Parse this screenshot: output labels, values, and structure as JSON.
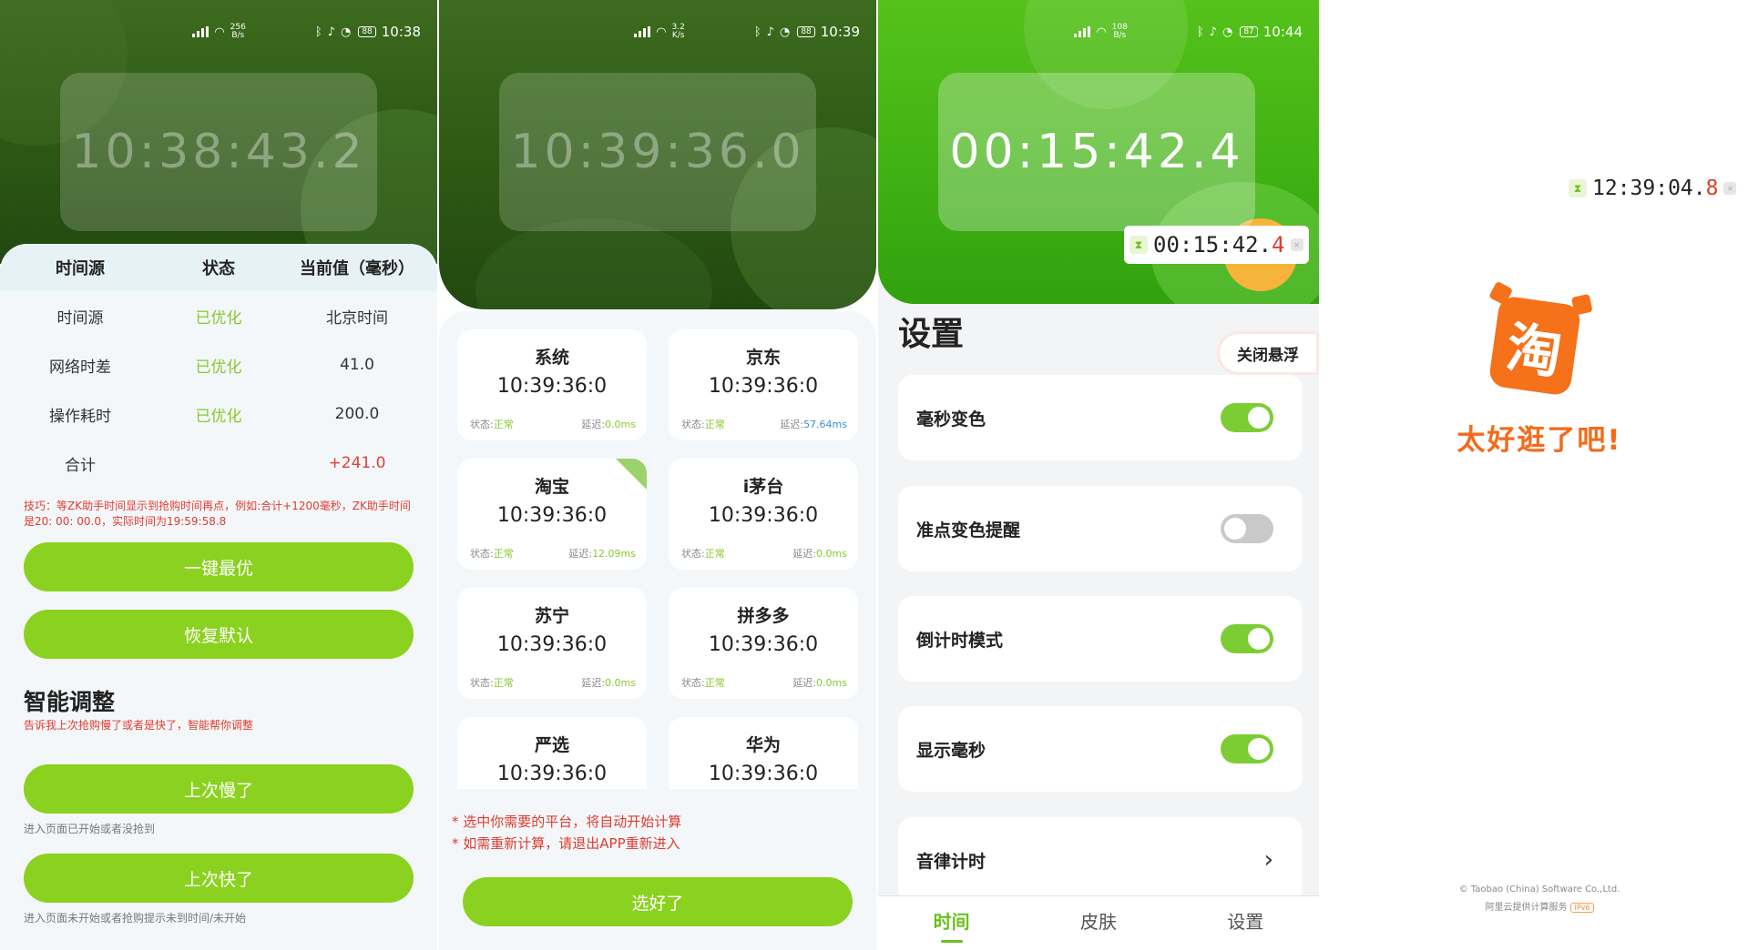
{
  "screen1": {
    "status": {
      "speed_top": "256",
      "speed_unit": "B/s",
      "battery": "88",
      "time": "10:38"
    },
    "clock": "10:38:43.2",
    "table": {
      "headers": [
        "时间源",
        "状态",
        "当前值（毫秒）"
      ],
      "rows": [
        {
          "name": "时间源",
          "status": "已优化",
          "value": "北京时间"
        },
        {
          "name": "网络时差",
          "status": "已优化",
          "value": "41.0"
        },
        {
          "name": "操作耗时",
          "status": "已优化",
          "value": "200.0"
        }
      ],
      "total_label": "合计",
      "total_value": "+241.0"
    },
    "tip": "技巧：等ZK助手时间显示到抢购时间再点，例如:合计+1200毫秒，ZK助手时间是20: 00: 00.0，实际时间为19:59:58.8",
    "btn_best": "一键最优",
    "btn_reset": "恢复默认",
    "smart_title": "智能调整",
    "smart_sub": "告诉我上次抢购慢了或者是快了，智能帮你调整",
    "btn_slow": "上次慢了",
    "slow_hint": "进入页面已开始或者没抢到",
    "btn_fast": "上次快了",
    "fast_hint": "进入页面未开始或者抢购提示未到时间/未开始"
  },
  "screen2": {
    "status": {
      "speed_top": "3.2",
      "speed_unit": "K/s",
      "battery": "88",
      "time": "10:39"
    },
    "clock": "10:39:36.0",
    "status_label": "状态:",
    "delay_label": "延迟:",
    "platforms": [
      {
        "name": "系统",
        "time": "10:39:36:0",
        "state": "正常",
        "delay": "0.0ms"
      },
      {
        "name": "京东",
        "time": "10:39:36:0",
        "state": "正常",
        "delay": "57.64ms"
      },
      {
        "name": "淘宝",
        "time": "10:39:36:0",
        "state": "正常",
        "delay": "12.09ms"
      },
      {
        "name": "i茅台",
        "time": "10:39:36:0",
        "state": "正常",
        "delay": "0.0ms"
      },
      {
        "name": "苏宁",
        "time": "10:39:36:0",
        "state": "正常",
        "delay": "0.0ms"
      },
      {
        "name": "拼多多",
        "time": "10:39:36:0",
        "state": "正常",
        "delay": "0.0ms"
      },
      {
        "name": "严选",
        "time": "10:39:36:0",
        "state": "",
        "delay": ""
      },
      {
        "name": "华为",
        "time": "10:39:36:0",
        "state": "",
        "delay": ""
      }
    ],
    "note1": "* 选中你需要的平台，将自动开始计算",
    "note2": "* 如需重新计算，请退出APP重新进入",
    "btn_done": "选好了"
  },
  "screen3": {
    "status": {
      "speed_top": "108",
      "speed_unit": "B/s",
      "battery": "87",
      "time": "10:44"
    },
    "clock": "00:15:42.4",
    "float_main": "00:15:42.",
    "float_ms": "4",
    "title": "设置",
    "close_float": "关闭悬浮",
    "settings": [
      {
        "label": "毫秒变色",
        "on": true
      },
      {
        "label": "准点变色提醒",
        "on": false
      },
      {
        "label": "倒计时模式",
        "on": true
      },
      {
        "label": "显示毫秒",
        "on": true
      },
      {
        "label": "音律计时"
      }
    ],
    "tabs": [
      "时间",
      "皮肤",
      "设置"
    ]
  },
  "screen4": {
    "float_main": "12:39:04.",
    "float_ms": "8",
    "logo_char": "淘",
    "slogan": "太好逛了吧!",
    "copyright": "© Taobao (China) Software Co.,Ltd.",
    "cloud": "阿里云提供计算服务",
    "ipv6": "IPv6"
  },
  "colors": {
    "accent": "#8bd120",
    "ok": "#86c92e",
    "warn": "#e03b2f",
    "taobao": "#f5711a"
  }
}
